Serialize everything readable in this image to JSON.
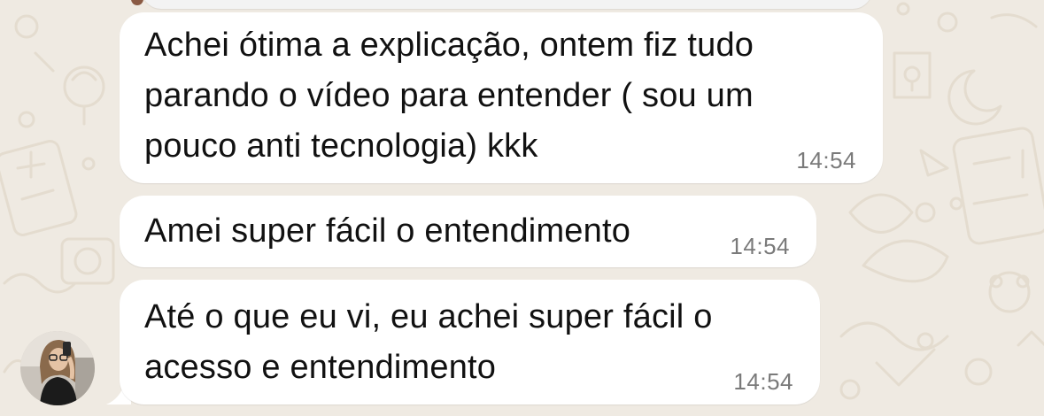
{
  "chat": {
    "messages": [
      {
        "text": "Achei ótima a explicação, ontem fiz tudo\nparando o vídeo para entender ( sou um\npouco anti tecnologia) kkk",
        "time": "14:54"
      },
      {
        "text": "Amei super fácil o entendimento",
        "time": "14:54"
      },
      {
        "text": "Até o que eu vi, eu achei super fácil o\nacesso e entendimento",
        "time": "14:54"
      }
    ],
    "sender_avatar": "profile-photo"
  },
  "colors": {
    "wallpaper": "#efeae2",
    "bubble": "#ffffff",
    "text": "#111111",
    "timestamp": "#7a7a7a"
  },
  "icons": [
    "doodle-wallpaper-pattern",
    "avatar-photo"
  ]
}
